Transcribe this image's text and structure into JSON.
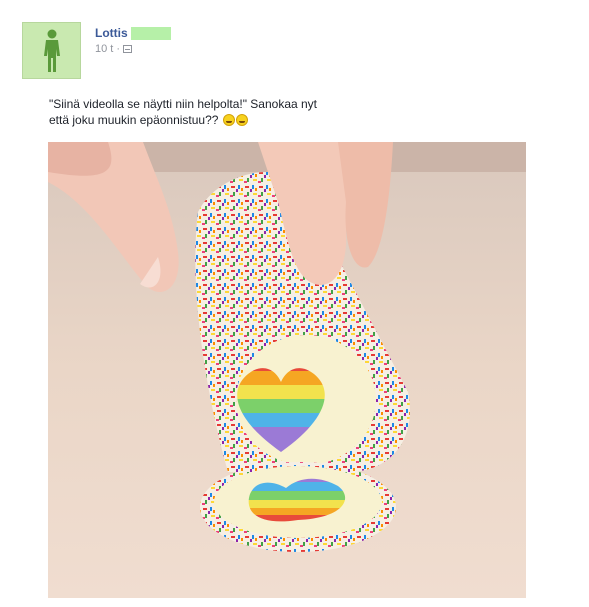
{
  "post": {
    "author_name": "Lottis",
    "time": "10 t",
    "separator": "·",
    "text_line1": "\"Siinä videolla se näytti niin helpolta!\" Sanokaa nyt",
    "text_line2": "että joku muukin epäonnistuu??",
    "emoji": [
      "grinning-sweat-emoji",
      "grinning-sweat-emoji"
    ]
  },
  "colors": {
    "link": "#3b5998",
    "meta": "#90949c",
    "avatar_bg": "#c9e9b0",
    "avatar_figure": "#5a9a3a",
    "name_redaction": "#b6f0a8"
  },
  "icons": {
    "avatar": "person-silhouette-icon",
    "audience": "audience-icon"
  }
}
